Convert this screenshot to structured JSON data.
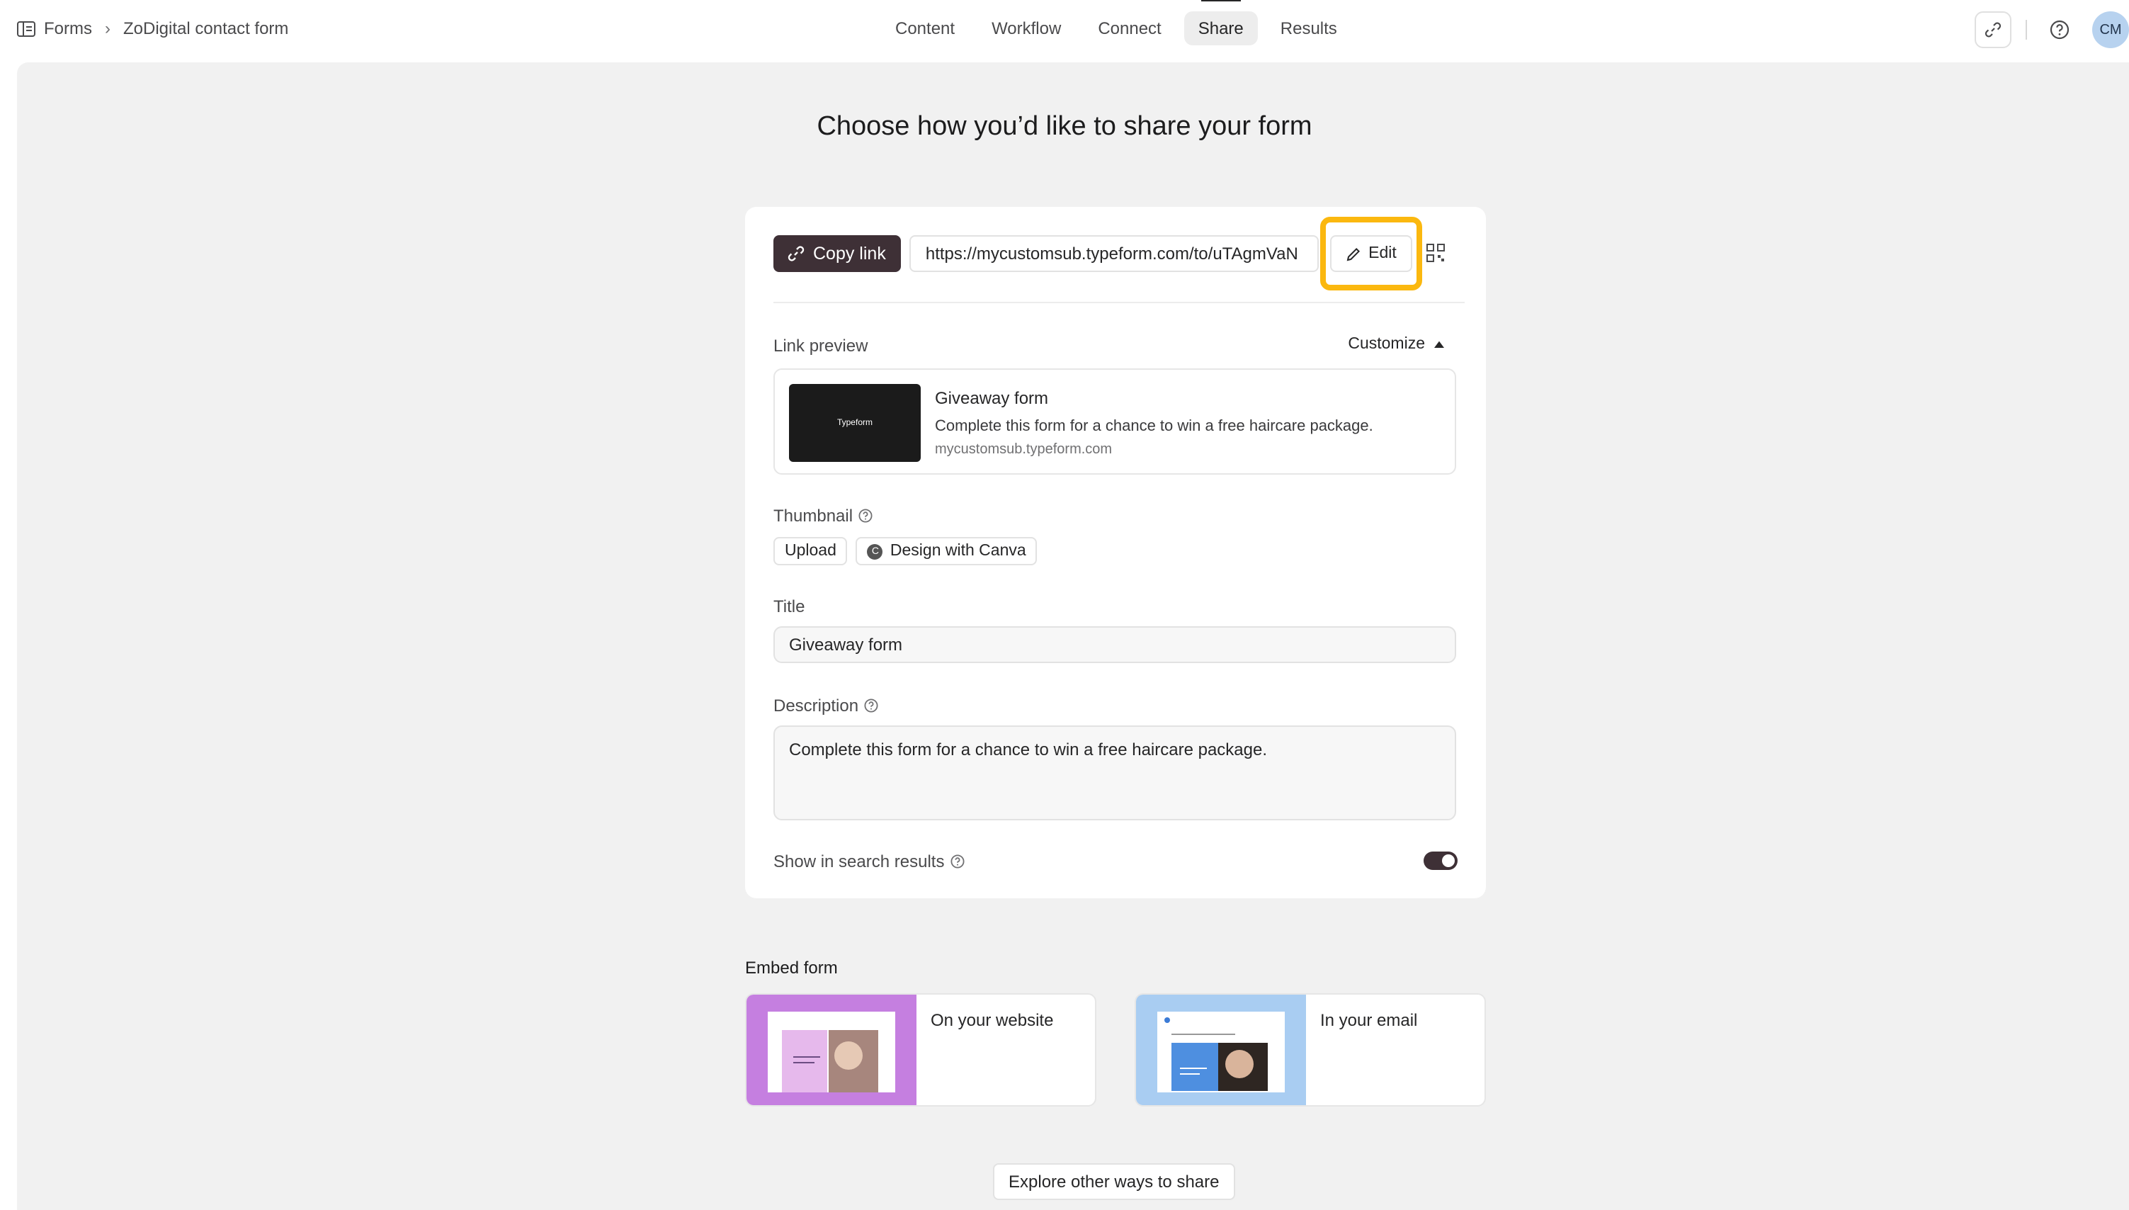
{
  "breadcrumb": {
    "root": "Forms",
    "current": "ZoDigital contact form"
  },
  "tabs": [
    {
      "label": "Content"
    },
    {
      "label": "Workflow"
    },
    {
      "label": "Connect"
    },
    {
      "label": "Share",
      "active": true
    },
    {
      "label": "Results"
    }
  ],
  "header": {
    "avatar_initials": "CM"
  },
  "main": {
    "heading": "Choose how you’d like to share your form",
    "copy_link_label": "Copy link",
    "url": "https://mycustomsub.typeform.com/to/uTAgmVaN",
    "edit_label": "Edit",
    "link_preview_label": "Link preview",
    "customize_label": "Customize",
    "preview": {
      "thumb_text": "Typeform",
      "title": "Giveaway form",
      "description": "Complete this form for a chance to win a free haircare package.",
      "domain": "mycustomsub.typeform.com"
    },
    "thumbnail_label": "Thumbnail",
    "upload_label": "Upload",
    "canva_label": "Design with Canva",
    "title_label": "Title",
    "title_value": "Giveaway form",
    "description_label": "Description",
    "description_value": "Complete this form for a chance to win a free haircare package.",
    "search_results_label": "Show in search results",
    "search_results_on": true
  },
  "embed": {
    "title": "Embed form",
    "website_label": "On your website",
    "email_label": "In your email",
    "website_color": "#c57fe0",
    "email_color": "#a9cdf2"
  },
  "explore_label": "Explore other ways to share",
  "colors": {
    "highlight": "#fbb80f",
    "primary_button": "#3e3036"
  }
}
